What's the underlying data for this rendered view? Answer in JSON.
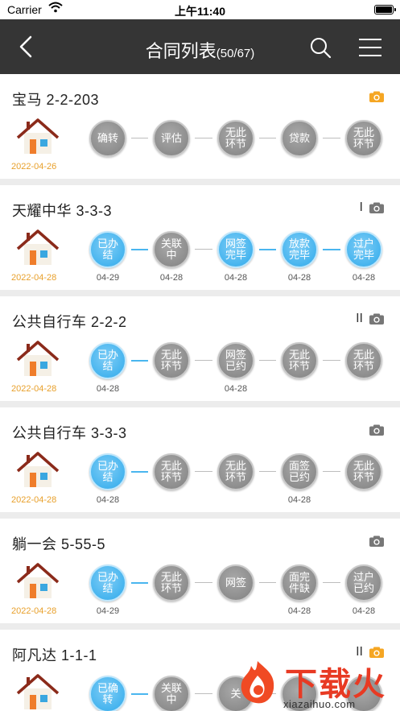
{
  "status": {
    "carrier": "Carrier",
    "time": "上午11:40"
  },
  "nav": {
    "title": "合同列表",
    "count": "(50/67)"
  },
  "cards": [
    {
      "name": "宝马  2-2-203",
      "mark": "",
      "camera_color": "#f5a623",
      "date": "2022-04-26",
      "nodes": [
        {
          "label": "确转",
          "state": "grey",
          "date": ""
        },
        {
          "label": "评估",
          "state": "grey",
          "date": ""
        },
        {
          "label": "无此环节",
          "state": "grey",
          "date": ""
        },
        {
          "label": "贷款",
          "state": "grey",
          "date": ""
        },
        {
          "label": "无此环节",
          "state": "grey",
          "date": ""
        }
      ]
    },
    {
      "name": "天耀中华  3-3-3",
      "mark": "I",
      "camera_color": "#777777",
      "date": "2022-04-28",
      "nodes": [
        {
          "label": "已办结",
          "state": "blue",
          "date": "04-29"
        },
        {
          "label": "关联中",
          "state": "grey",
          "date": "04-28"
        },
        {
          "label": "网签完毕",
          "state": "blue",
          "date": "04-28"
        },
        {
          "label": "放款完毕",
          "state": "blue",
          "date": "04-28"
        },
        {
          "label": "过户完毕",
          "state": "blue",
          "date": "04-28"
        }
      ]
    },
    {
      "name": "公共自行车  2-2-2",
      "mark": "II",
      "camera_color": "#777777",
      "date": "2022-04-28",
      "nodes": [
        {
          "label": "已办结",
          "state": "blue",
          "date": "04-28"
        },
        {
          "label": "无此环节",
          "state": "grey",
          "date": ""
        },
        {
          "label": "网签已约",
          "state": "grey",
          "date": "04-28"
        },
        {
          "label": "无此环节",
          "state": "grey",
          "date": ""
        },
        {
          "label": "无此环节",
          "state": "grey",
          "date": ""
        }
      ]
    },
    {
      "name": "公共自行车  3-3-3",
      "mark": "",
      "camera_color": "#777777",
      "date": "2022-04-28",
      "nodes": [
        {
          "label": "已办结",
          "state": "blue",
          "date": "04-28"
        },
        {
          "label": "无此环节",
          "state": "grey",
          "date": ""
        },
        {
          "label": "无此环节",
          "state": "grey",
          "date": ""
        },
        {
          "label": "面签已约",
          "state": "grey",
          "date": "04-28"
        },
        {
          "label": "无此环节",
          "state": "grey",
          "date": ""
        }
      ]
    },
    {
      "name": "躺一会  5-55-5",
      "mark": "",
      "camera_color": "#777777",
      "date": "2022-04-28",
      "nodes": [
        {
          "label": "已办结",
          "state": "blue",
          "date": "04-29"
        },
        {
          "label": "无此环节",
          "state": "grey",
          "date": ""
        },
        {
          "label": "网签",
          "state": "grey",
          "date": ""
        },
        {
          "label": "面完件缺",
          "state": "grey",
          "date": "04-28"
        },
        {
          "label": "过户已约",
          "state": "grey",
          "date": "04-28"
        }
      ]
    },
    {
      "name": "阿凡达  1-1-1",
      "mark": "II",
      "camera_color": "#f5a623",
      "date": "",
      "nodes": [
        {
          "label": "已确转",
          "state": "blue",
          "date": ""
        },
        {
          "label": "关联中",
          "state": "grey",
          "date": ""
        },
        {
          "label": "关",
          "state": "grey",
          "date": ""
        },
        {
          "label": "",
          "state": "grey",
          "date": ""
        },
        {
          "label": "",
          "state": "grey",
          "date": ""
        }
      ]
    }
  ],
  "watermark": {
    "text": "下载火",
    "url": "xiazaihuo.com"
  }
}
